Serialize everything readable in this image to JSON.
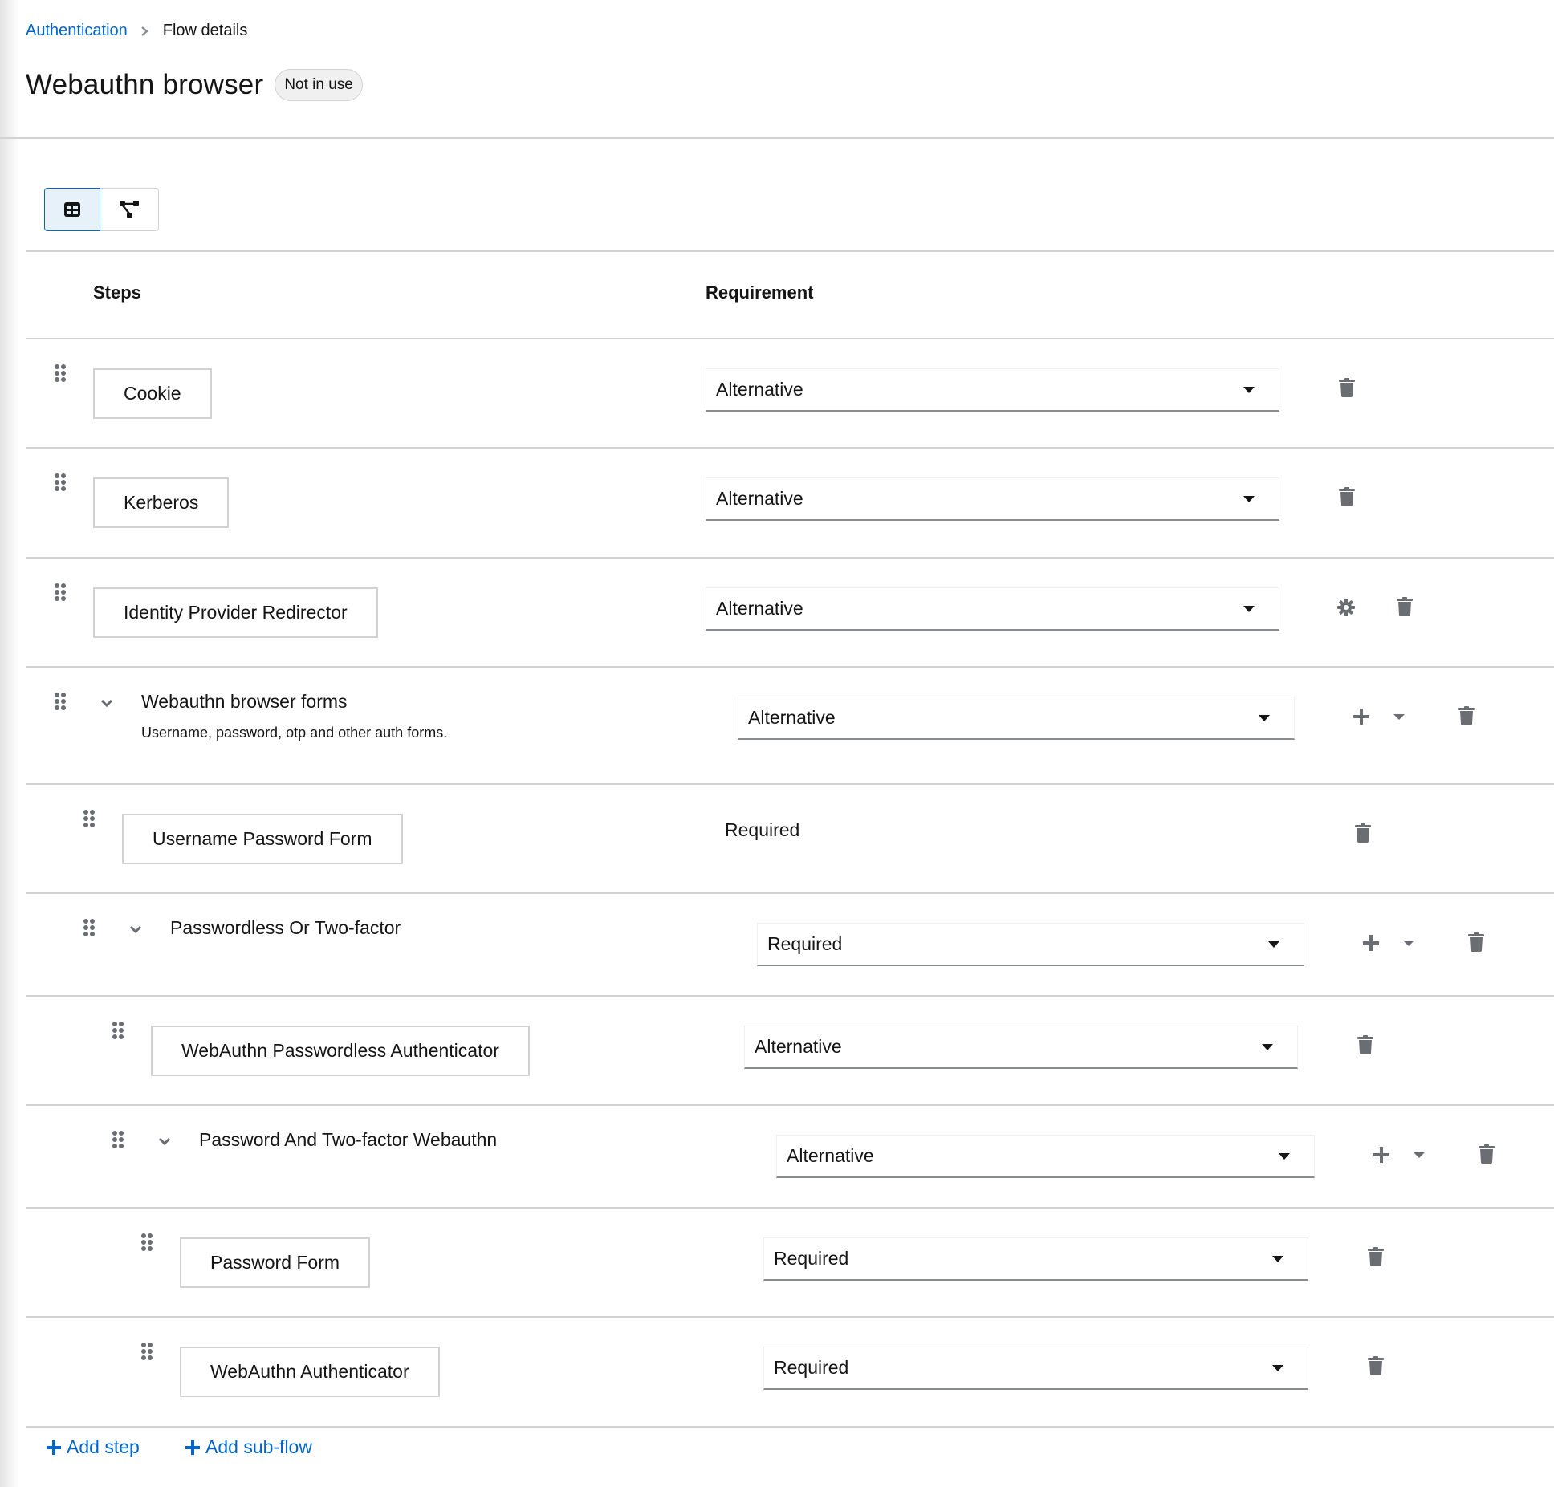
{
  "breadcrumb": {
    "parent": "Authentication",
    "current": "Flow details"
  },
  "header": {
    "title": "Webauthn browser",
    "badge": "Not in use"
  },
  "view_toggle": {
    "items": [
      {
        "name": "table-view",
        "icon": "table-icon",
        "selected": true
      },
      {
        "name": "diagram-view",
        "icon": "topology-icon",
        "selected": false
      }
    ]
  },
  "table": {
    "columns": [
      "Steps",
      "Requirement"
    ],
    "rows": [
      {
        "type": "execution",
        "level": 0,
        "name": "Cookie",
        "requirement": "Alternative",
        "requirement_editable": true,
        "actions": [
          "delete"
        ]
      },
      {
        "type": "execution",
        "level": 0,
        "name": "Kerberos",
        "requirement": "Alternative",
        "requirement_editable": true,
        "actions": [
          "delete"
        ]
      },
      {
        "type": "execution",
        "level": 0,
        "name": "Identity Provider Redirector",
        "requirement": "Alternative",
        "requirement_editable": true,
        "actions": [
          "settings",
          "delete"
        ]
      },
      {
        "type": "subflow",
        "level": 0,
        "name": "Webauthn browser forms",
        "description": "Username, password, otp and other auth forms.",
        "expanded": true,
        "requirement": "Alternative",
        "requirement_editable": true,
        "actions": [
          "add",
          "delete"
        ]
      },
      {
        "type": "execution",
        "level": 1,
        "name": "Username Password Form",
        "requirement": "Required",
        "requirement_editable": false,
        "actions": [
          "delete"
        ]
      },
      {
        "type": "subflow",
        "level": 1,
        "name": "Passwordless Or Two-factor",
        "expanded": true,
        "requirement": "Required",
        "requirement_editable": true,
        "actions": [
          "add",
          "delete"
        ]
      },
      {
        "type": "execution",
        "level": 2,
        "name": "WebAuthn Passwordless Authenticator",
        "requirement": "Alternative",
        "requirement_editable": true,
        "actions": [
          "delete"
        ]
      },
      {
        "type": "subflow",
        "level": 2,
        "name": "Password And Two-factor Webauthn",
        "expanded": true,
        "requirement": "Alternative",
        "requirement_editable": true,
        "actions": [
          "add",
          "delete"
        ]
      },
      {
        "type": "execution",
        "level": 3,
        "name": "Password Form",
        "requirement": "Required",
        "requirement_editable": true,
        "actions": [
          "delete"
        ]
      },
      {
        "type": "execution",
        "level": 3,
        "name": "WebAuthn Authenticator",
        "requirement": "Required",
        "requirement_editable": true,
        "actions": [
          "delete"
        ]
      }
    ]
  },
  "footer": {
    "add_step": "Add step",
    "add_subflow": "Add sub-flow"
  },
  "colors": {
    "link": "#0066cc",
    "text": "#151515",
    "icon": "#6a6e73",
    "border": "#d2d2d2",
    "selected_bg": "#e7f1fa"
  }
}
